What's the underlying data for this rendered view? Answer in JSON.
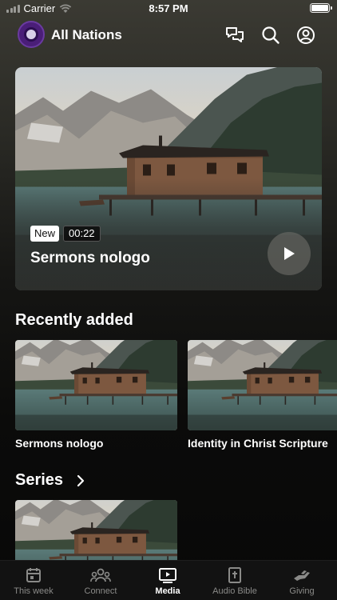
{
  "status_bar": {
    "carrier": "Carrier",
    "time": "8:57 PM"
  },
  "header": {
    "title": "All Nations",
    "icons": [
      "chat-icon",
      "search-icon",
      "profile-icon"
    ]
  },
  "featured": {
    "badge": "New",
    "duration": "00:22",
    "title": "Sermons nologo"
  },
  "recently_added": {
    "heading": "Recently added",
    "items": [
      {
        "title": "Sermons nologo"
      },
      {
        "title": "Identity in Christ Scripture"
      }
    ]
  },
  "series": {
    "heading": "Series"
  },
  "tab_bar": {
    "tabs": [
      {
        "label": "This week",
        "icon": "calendar-icon"
      },
      {
        "label": "Connect",
        "icon": "people-icon"
      },
      {
        "label": "Media",
        "icon": "media-icon",
        "active": true
      },
      {
        "label": "Audio Bible",
        "icon": "bible-icon"
      },
      {
        "label": "Giving",
        "icon": "giving-hand-icon"
      }
    ]
  },
  "colors": {
    "background": "#0b0b0a",
    "tab_active": "#ffffff",
    "tab_inactive": "#8a8a88",
    "logo": "#4a1e78"
  }
}
